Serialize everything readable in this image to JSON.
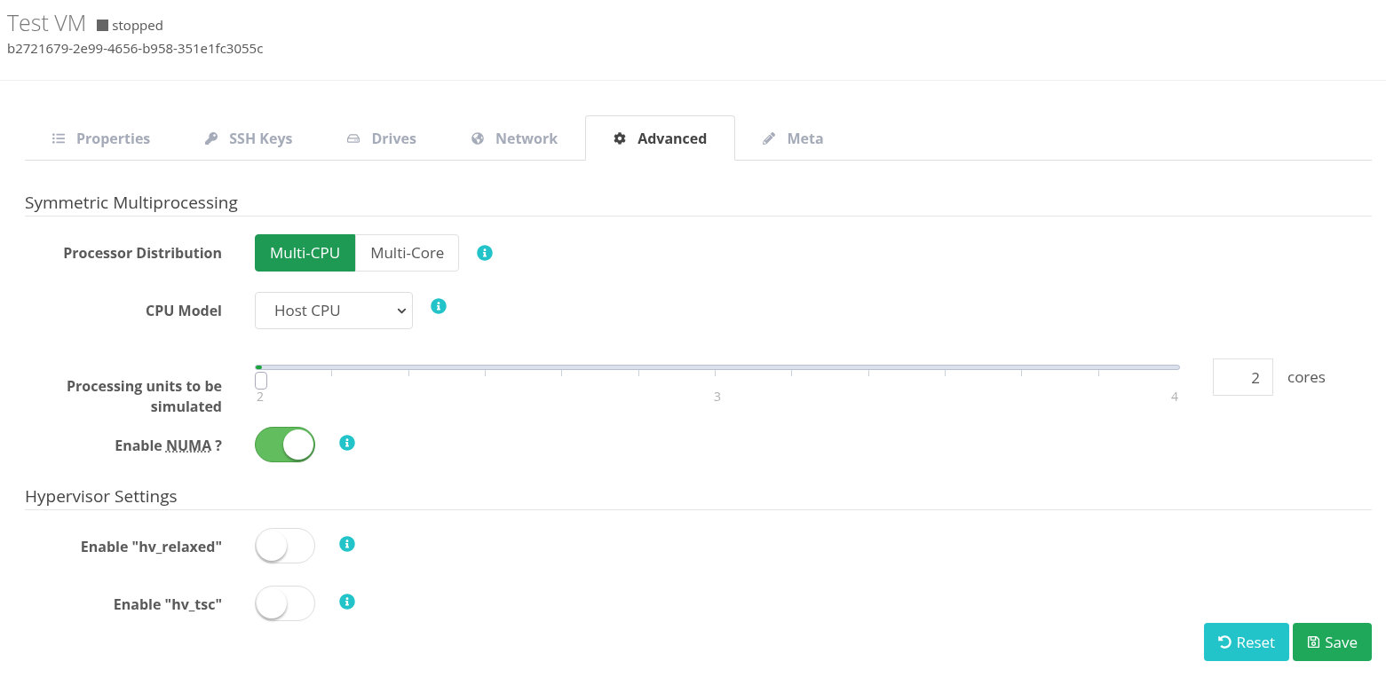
{
  "header": {
    "title": "Test VM",
    "status": "stopped",
    "uuid": "b2721679-2e99-4656-b958-351e1fc3055c"
  },
  "tabs": [
    {
      "label": "Properties",
      "selected": false
    },
    {
      "label": "SSH Keys",
      "selected": false
    },
    {
      "label": "Drives",
      "selected": false
    },
    {
      "label": "Network",
      "selected": false
    },
    {
      "label": "Advanced",
      "selected": true
    },
    {
      "label": "Meta",
      "selected": false
    }
  ],
  "sections": [
    {
      "title": "Symmetric Multiprocessing",
      "rows": [
        {
          "kind": "segmented",
          "label": "Processor Distribution",
          "options": [
            {
              "label": "Multi-CPU",
              "selected": true
            },
            {
              "label": "Multi-Core",
              "selected": false
            }
          ],
          "info": true
        },
        {
          "kind": "select",
          "label": "CPU Model",
          "value": "Host CPU",
          "info": true
        },
        {
          "kind": "slider",
          "label": "Processing units to be simulated",
          "level": 0,
          "tick_labels": [
            "2",
            "3",
            "4"
          ],
          "value": "2",
          "unit": "cores"
        },
        {
          "kind": "toggle",
          "label": "Enable",
          "abbr": "NUMA",
          "suffix": "?",
          "on": true,
          "info": true
        }
      ]
    },
    {
      "title": "Hypervisor Settings",
      "rows": [
        {
          "kind": "toggle",
          "label": "Enable \"hv_relaxed\"",
          "on": false,
          "info": true
        },
        {
          "kind": "toggle",
          "label": "Enable \"hv_tsc\"",
          "on": false,
          "info": true
        }
      ]
    }
  ],
  "buttons": [
    {
      "label": "Reset",
      "kind": "reset"
    },
    {
      "label": "Save",
      "kind": "save"
    }
  ]
}
